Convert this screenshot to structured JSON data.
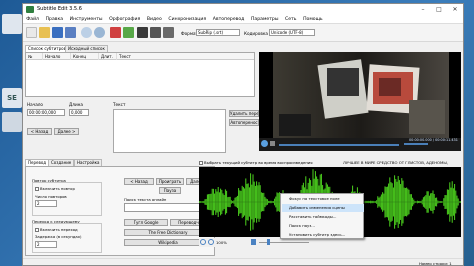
{
  "desktop": {
    "icons": [
      "",
      "SE",
      ""
    ]
  },
  "window": {
    "title": "Subtitle Edit 3.5.6"
  },
  "menu": [
    "Файл",
    "Правка",
    "Инструменты",
    "Орфография",
    "Видео",
    "Синхронизация",
    "Автоперевод",
    "Параметры",
    "Сеть",
    "Помощь"
  ],
  "toolbar": {
    "format_label": "Формат",
    "format_value": "SubRip (.srt)",
    "encoding_label": "Кодировка",
    "encoding_value": "Unicode (UTF-8)"
  },
  "subtitle_tabs": [
    "Список субтитров",
    "Исходный список"
  ],
  "columns": [
    "№",
    "Начало",
    "Конец",
    "Длит.",
    "Текст"
  ],
  "editor": {
    "start_label": "Начало",
    "start_value": "00:00:00,000",
    "duration_label": "Длина",
    "duration_value": "0,000",
    "text_label": "Текст",
    "prev_button": "< Назад",
    "next_button": "Далее >",
    "split_button": "Удалить перенос",
    "autobreak_button": "Автоперенос"
  },
  "lower_tabs": [
    "Перевод",
    "Создание",
    "Настройка"
  ],
  "translate": {
    "loop_group": "Повтор субтитра",
    "loop_enable": "Включить повтор",
    "loop_count_label": "Число повторов",
    "loop_count_value": "2",
    "move_group": "Переход к следующему",
    "move_enable": "Включить переход",
    "delay_label": "Задержка (в секундах)",
    "delay_value": "2",
    "prev_button": "< Назад",
    "play_button": "Проиграть",
    "next_button": "Далее >",
    "pause_button": "Пауза",
    "search_label": "Поиск текста онлайн",
    "google_it": "Гугл Google",
    "google_translate": "Переводчик",
    "free_dictionary": "The Free Dictionary",
    "wikipedia": "Wikipedia"
  },
  "waveform": {
    "select_current": "Выбрать текущий субтитр во время воспроизведения",
    "title_text": "ЛУЧШЕЕ В МИРЕ СРЕДСТВО ОТ ГЛИСТОВ, АДЕНОМЫ,",
    "zoom_value": "100%",
    "wave_color": "#4cd21e",
    "bg_color": "#000000"
  },
  "context_menu": [
    "Фокус на текстовое поле",
    "Добавить изменения сцены",
    "Расставить таймкоды...",
    "Поиск пауз...",
    "Установить субтитр здесь..."
  ],
  "video": {
    "time": "00:00:00.000 / 00:00:11.431"
  },
  "status": {
    "line_number": "Номер строки: 1"
  }
}
